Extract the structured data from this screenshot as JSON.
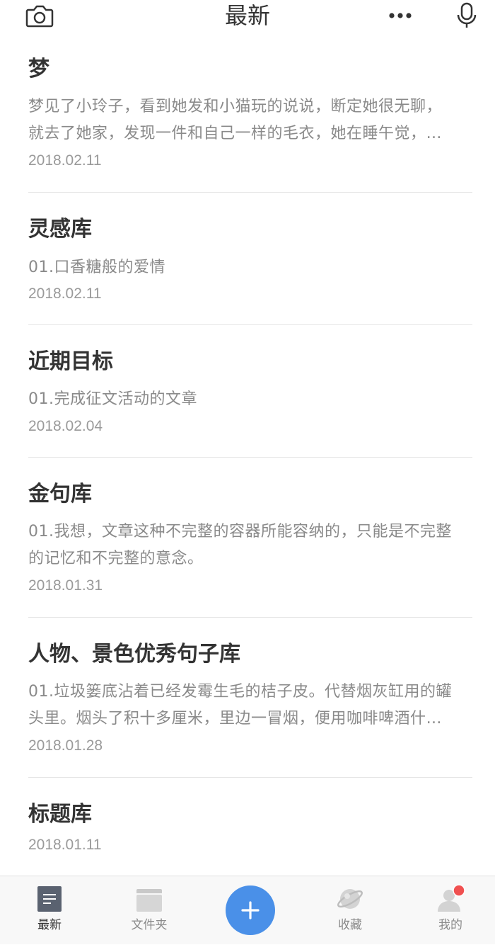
{
  "header": {
    "title": "最新",
    "left_icon": "camera-icon",
    "right_icons": [
      "more-icon",
      "microphone-icon"
    ]
  },
  "notes": [
    {
      "title": "梦",
      "excerpt_line1": "梦见了小玲子，看到她发和小猫玩的说说，断定她很无聊，",
      "excerpt_line2": "就去了她家，发现一件和自己一样的毛衣，她在睡午觉，…",
      "date": "2018.02.11"
    },
    {
      "title": "灵感库",
      "excerpt_line1": "01.口香糖般的爱情",
      "date": "2018.02.11"
    },
    {
      "title": "近期目标",
      "excerpt_line1": "01.完成征文活动的文章",
      "date": "2018.02.04"
    },
    {
      "title": "金句库",
      "excerpt_line1": "01.我想，文章这种不完整的容器所能容纳的，只能是不完整",
      "excerpt_line2": "的记忆和不完整的意念。",
      "date": "2018.01.31"
    },
    {
      "title": "人物、景色优秀句子库",
      "excerpt_line1": "01.垃圾篓底沾着已经发霉生毛的桔子皮。代替烟灰缸用的罐",
      "excerpt_line2": "头里。烟头了积十多厘米，里边一冒烟，便用咖啡啤酒什…",
      "date": "2018.01.28"
    },
    {
      "title": "标题库",
      "date": "2018.01.11"
    }
  ],
  "tabbar": {
    "tabs": [
      {
        "label": "最新",
        "icon": "note-icon",
        "active": true
      },
      {
        "label": "文件夹",
        "icon": "folder-icon",
        "active": false
      },
      {
        "label": "收藏",
        "icon": "planet-icon",
        "active": false
      },
      {
        "label": "我的",
        "icon": "user-icon",
        "active": false,
        "badge": true
      }
    ],
    "add_icon": "plus-icon"
  },
  "colors": {
    "accent": "#4a90e8",
    "badge": "#f05050",
    "text_primary": "#333333",
    "text_secondary": "#8a8a8a",
    "divider": "#e6e6e6"
  }
}
